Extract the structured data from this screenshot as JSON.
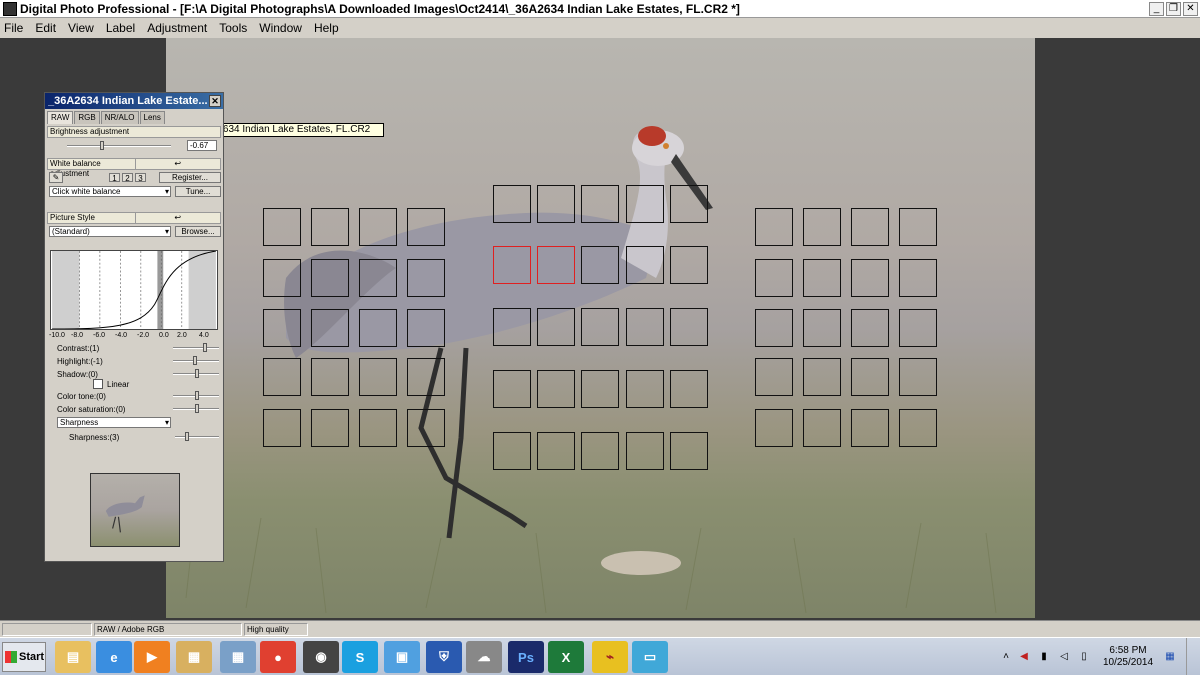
{
  "window": {
    "title": "Digital Photo Professional - [F:\\A Digital Photographs\\A Downloaded Images\\Oct2414\\_36A2634  Indian Lake Estates, FL.CR2 *]",
    "minimize": "_",
    "restore": "❐",
    "close": "✕"
  },
  "menu": [
    "File",
    "Edit",
    "View",
    "Label",
    "Adjustment",
    "Tools",
    "Window",
    "Help"
  ],
  "palette": {
    "title": "_36A2634  Indian Lake Estate...",
    "close": "✕",
    "tabs": [
      "RAW",
      "RGB",
      "NR/ALO",
      "Lens"
    ],
    "brightness": {
      "label": "Brightness adjustment",
      "value": "-0.67",
      "level": -0.67
    },
    "white_balance": {
      "label": "White balance adjustment",
      "presets": [
        "1",
        "2",
        "3"
      ],
      "register": "Register...",
      "mode": "Click white balance",
      "tune": "Tune..."
    },
    "picture_style": {
      "label": "Picture Style",
      "style": "(Standard)",
      "browse": "Browse...",
      "ticks": [
        "-10.0",
        "-8.0",
        "-6.0",
        "-4.0",
        "-2.0",
        "0.0",
        "2.0",
        "4.0"
      ],
      "contrast": "Contrast:(1)",
      "highlight": "Highlight:(-1)",
      "shadow": "Shadow:(0)",
      "linear": "Linear",
      "color_tone": "Color tone:(0)",
      "color_saturation": "Color saturation:(0)",
      "sharpness_mode": "Sharpness",
      "sharpness": "Sharpness:(3)"
    },
    "reset": "↩"
  },
  "tooltip": "_36A2634  Indian Lake Estates, FL.CR2",
  "statusbar": [
    "",
    "RAW / Adobe RGB",
    "High quality"
  ],
  "taskbar": {
    "start": "Start",
    "apps": [
      "explorer-icon",
      "ie-icon",
      "media-icon",
      "folder-icon",
      "calculator-icon",
      "chrome-icon",
      "camera-icon",
      "skype-icon",
      "app-icon",
      "security-icon",
      "weather-icon",
      "photoshop-icon",
      "excel-icon",
      "monitor-icon",
      "photo-icon"
    ],
    "ps_label": "Ps",
    "xl_label": "X",
    "sk_label": "S",
    "time": "6:58 PM",
    "date": "10/25/2014"
  },
  "colors": {
    "accent": "#0a246a",
    "af_active": "#e02020"
  }
}
